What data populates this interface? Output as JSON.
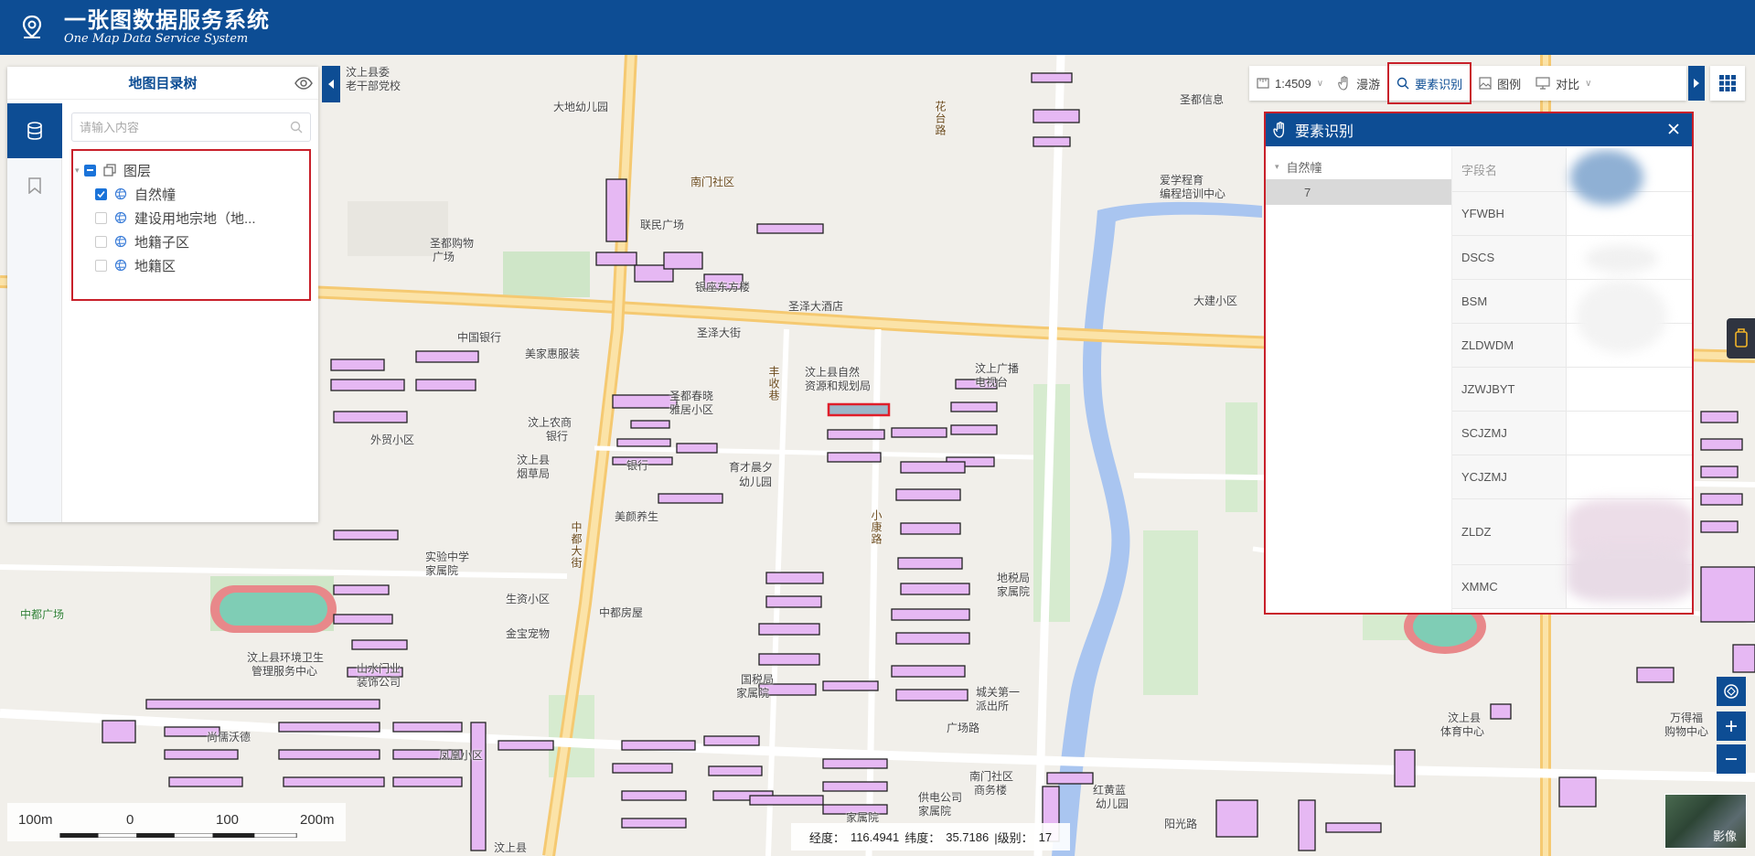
{
  "header": {
    "title_cn": "一张图数据服务系统",
    "title_en": "One Map Data Service System",
    "logo_icon": "location-pin-icon"
  },
  "left_panel": {
    "title": "地图目录树",
    "search_placeholder": "请输入内容",
    "tree": {
      "root": "图层",
      "items": [
        {
          "label": "自然幢",
          "checked": true
        },
        {
          "label": "建设用地宗地（地...",
          "checked": false
        },
        {
          "label": "地籍子区",
          "checked": false
        },
        {
          "label": "地籍区",
          "checked": false
        }
      ]
    }
  },
  "toolbar": {
    "scale": "1:4509",
    "roam": "漫游",
    "identify": "要素识别",
    "legend": "图例",
    "compare": "对比"
  },
  "identify_panel": {
    "title": "要素识别",
    "tree_root": "自然幢",
    "tree_child": "7",
    "field_header": "字段名",
    "fields": [
      "YFWBH",
      "DSCS",
      "BSM",
      "ZLDWDM",
      "JZWJBYT",
      "SCJZMJ",
      "YCJZMJ",
      "ZLDZ",
      "XMMC"
    ]
  },
  "scalebar": {
    "labels": [
      "100m",
      "0",
      "100",
      "200m"
    ]
  },
  "coords": {
    "lon_label": "经度：",
    "lon": "116.4941",
    "lat_label": "纬度：",
    "lat": "35.7186",
    "level_label": "|级别：",
    "level": "17"
  },
  "basemap_switch": "影像",
  "map_labels": [
    "汶上县委老干部党校",
    "大地幼儿园",
    "南门社区",
    "联民广场",
    "圣都购物广场",
    "银座东方楼",
    "圣泽大酒店",
    "圣泽大街",
    "中国银行",
    "美家惠服装",
    "汶上县自然资源和规划局",
    "汶上广播电视台",
    "圣都春晓雅居小区",
    "汶上农商银行",
    "外贸小区",
    "汶上县烟草局",
    "银行",
    "育才晨夕幼儿园",
    "美颜养生",
    "实验中学家属院",
    "生资小区",
    "金宝宠物",
    "中都房屋",
    "中都广场",
    "汶上县环境卫生管理服务中心",
    "山水门业装饰公司",
    "尚儒沃德",
    "凤凰小区",
    "国税局家属院",
    "地税局家属院",
    "城关第一派出所",
    "广场路",
    "南门社区商务楼",
    "红黄蓝幼儿园",
    "供电公司家属院",
    "阳光路",
    "汶上县体育中心",
    "万得福购物中心",
    "爱学程育编程培训中心",
    "圣都信息",
    "大建小区",
    "丰收巷",
    "小康路",
    "中都大街",
    "花台路",
    "银行",
    "家属院"
  ]
}
